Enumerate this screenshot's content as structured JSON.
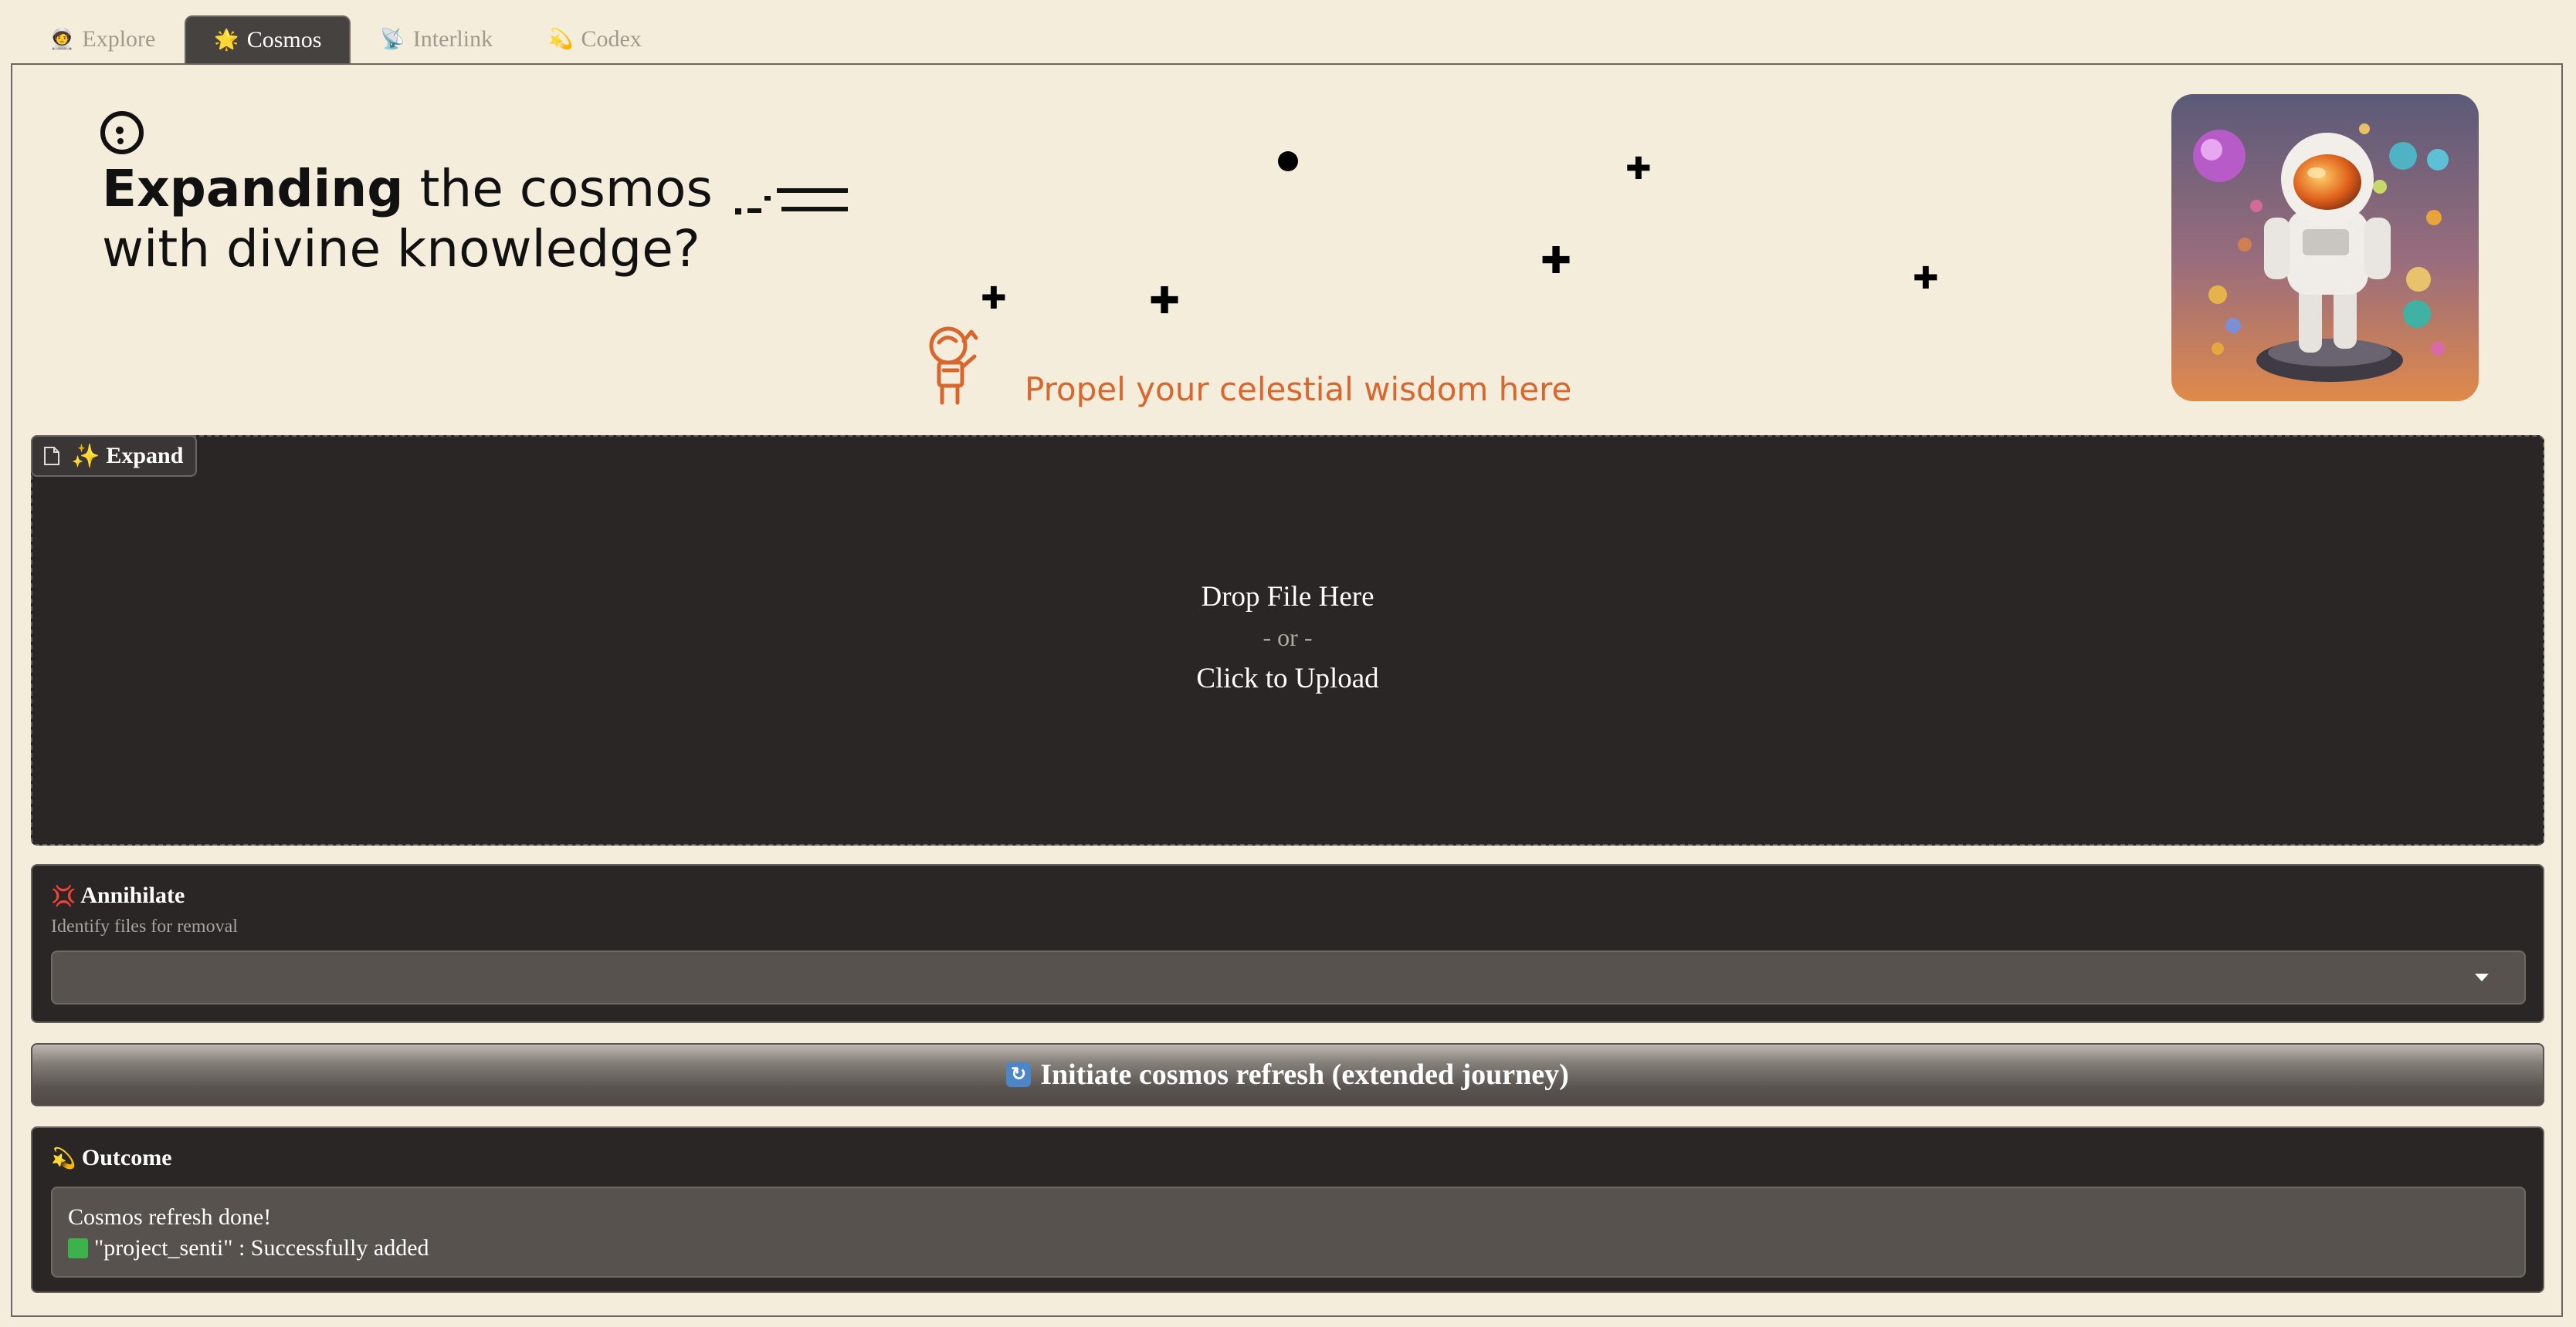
{
  "tabs": [
    {
      "icon": "🧑‍🚀",
      "label": "Explore",
      "active": false
    },
    {
      "icon": "🌟",
      "label": "Cosmos",
      "active": true
    },
    {
      "icon": "📡",
      "label": "Interlink",
      "active": false
    },
    {
      "icon": "💫",
      "label": "Codex",
      "active": false
    }
  ],
  "hero": {
    "title_bold": "Expanding",
    "title_rest": " the cosmos",
    "title_line2": "with divine knowledge?",
    "cta": "Propel your celestial wisdom here",
    "icons": [
      "cursor-face-icon",
      "dash-lines-icon",
      "astronaut-outline-icon",
      "astronaut-illustration"
    ]
  },
  "upload": {
    "label_icon": "✨",
    "label": "Expand",
    "drop": "Drop File Here",
    "or": "- or -",
    "click": "Click to Upload"
  },
  "annihilate": {
    "icon": "💢",
    "title": "Annihilate",
    "subtitle": "Identify files for removal",
    "selected": ""
  },
  "refresh": {
    "label": "Initiate cosmos refresh (extended journey)"
  },
  "outcome": {
    "icon": "💫",
    "title": "Outcome",
    "line1": "Cosmos refresh done!",
    "line2": "\"project_senti\" : Successfully added"
  },
  "colors": {
    "background": "#f5eddc",
    "panel_dark": "#2a2625",
    "accent_orange": "#d8662d"
  }
}
